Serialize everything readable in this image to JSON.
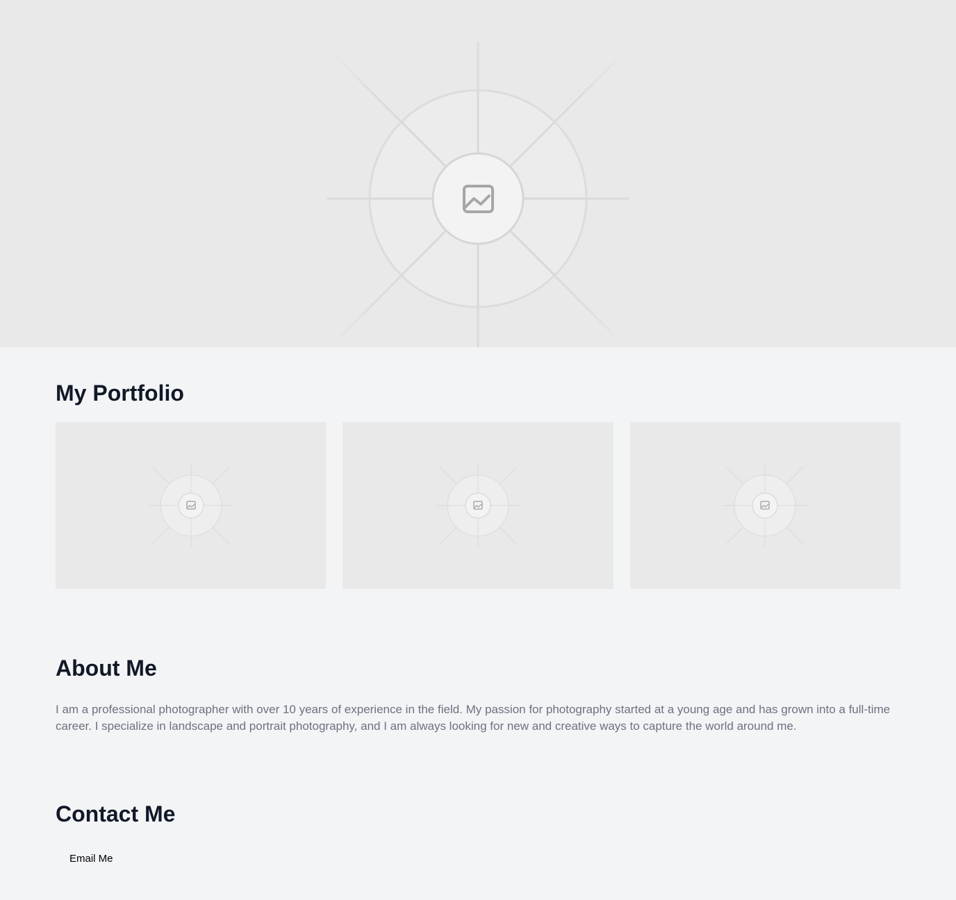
{
  "hero": {
    "image_icon": "image-placeholder-icon"
  },
  "portfolio": {
    "title": "My Portfolio",
    "items": [
      {
        "icon": "image-placeholder-icon"
      },
      {
        "icon": "image-placeholder-icon"
      },
      {
        "icon": "image-placeholder-icon"
      }
    ]
  },
  "about": {
    "title": "About Me",
    "text": "I am a professional photographer with over 10 years of experience in the field. My passion for photography started at a young age and has grown into a full-time career. I specialize in landscape and portrait photography, and I am always looking for new and creative ways to capture the world around me."
  },
  "contact": {
    "title": "Contact Me",
    "email_label": "Email Me"
  },
  "colors": {
    "page_background": "#f3f4f6",
    "placeholder_background": "#e9e9e9",
    "heading": "#111827",
    "body_text": "#6b7280"
  }
}
